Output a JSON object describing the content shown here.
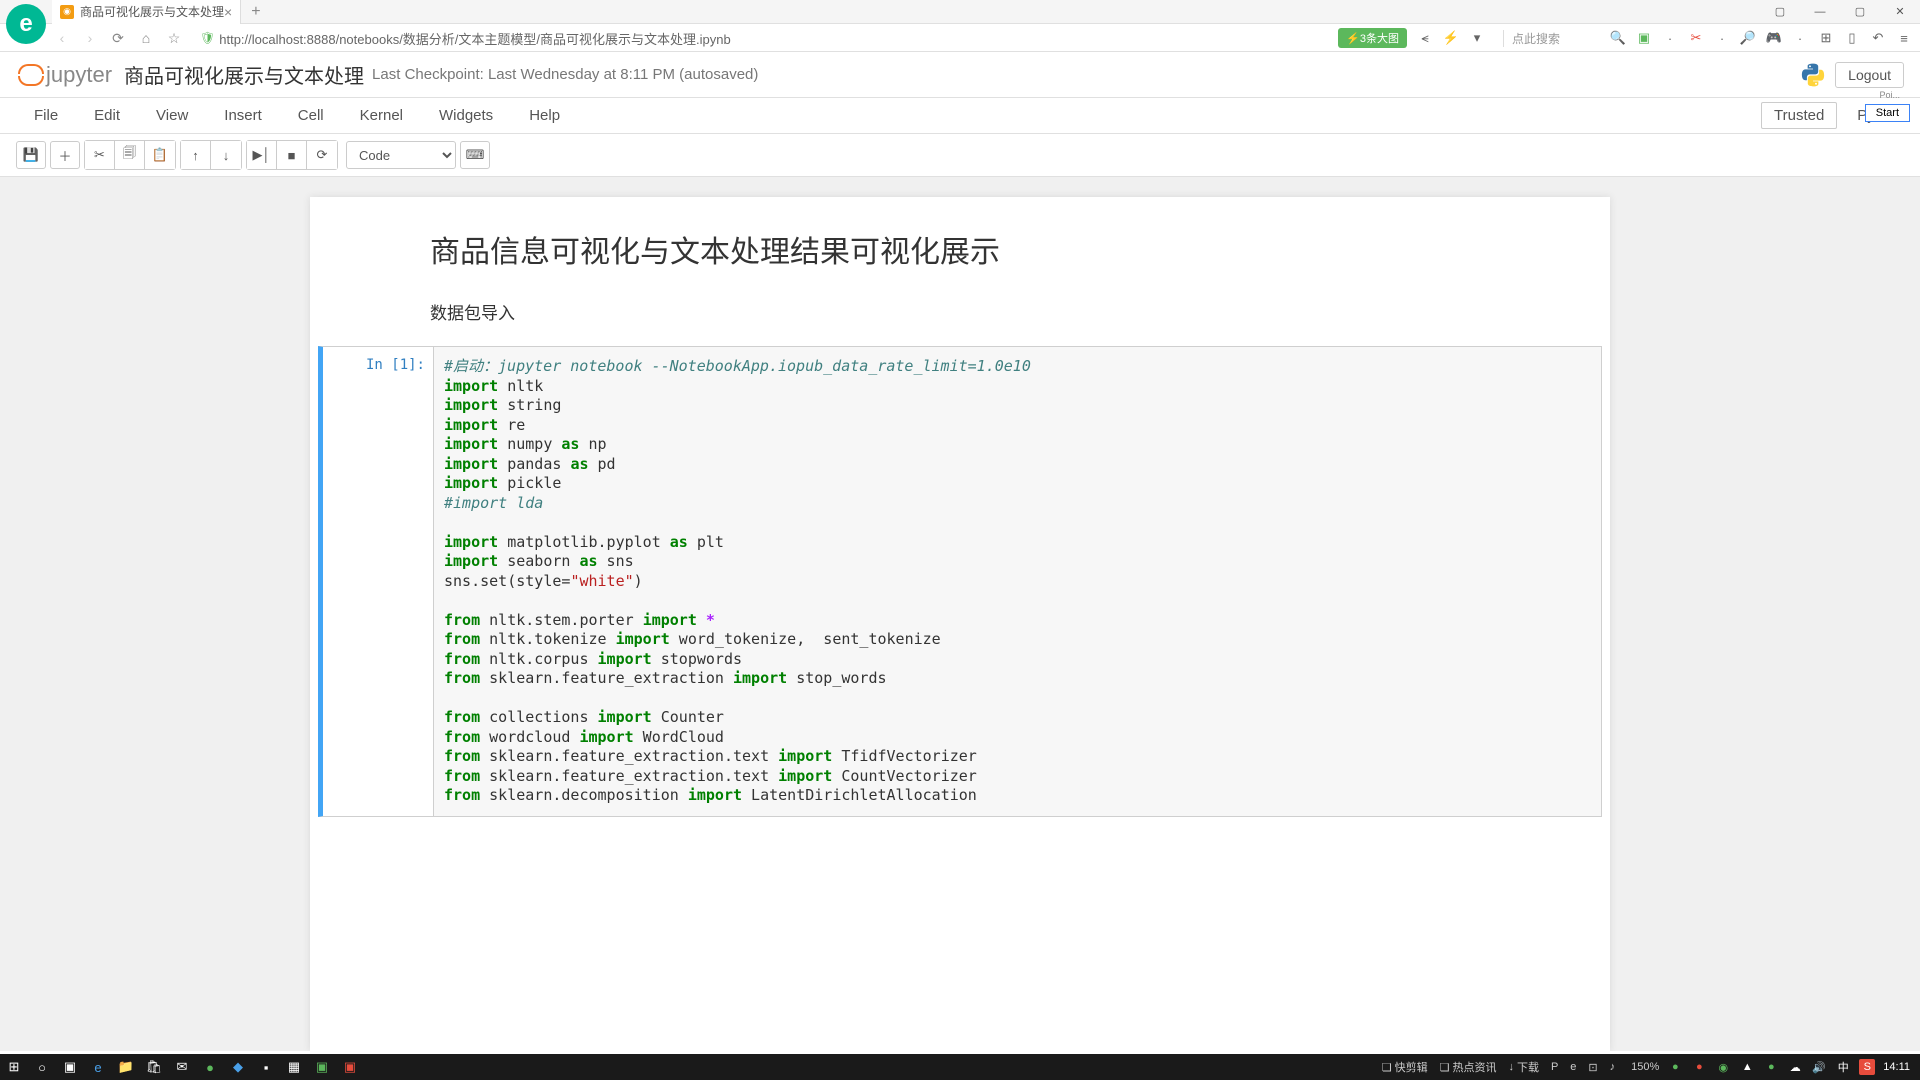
{
  "browser": {
    "tab_title": "商品可视化展示与文本处理",
    "url": "http://localhost:8888/notebooks/数据分析/文本主题模型/商品可视化展示与文本处理.ipynb",
    "ext_badge": "⚡3条大图",
    "search_hint": "点此搜索",
    "win": {
      "menu": "☰",
      "min": "—",
      "max": "▢",
      "close": "✕"
    }
  },
  "jupyter": {
    "logo_text": "jupyter",
    "title": "商品可视化展示与文本处理",
    "checkpoint": "Last Checkpoint: Last Wednesday at 8:11 PM (autosaved)",
    "logout": "Logout",
    "poi": "Poi...",
    "start": "Start"
  },
  "menu": {
    "items": [
      "File",
      "Edit",
      "View",
      "Insert",
      "Cell",
      "Kernel",
      "Widgets",
      "Help"
    ],
    "trusted": "Trusted",
    "kernel": "Python"
  },
  "toolbar": {
    "cell_type": "Code"
  },
  "notebook": {
    "heading": "商品信息可视化与文本处理结果可视化展示",
    "subtext": "数据包导入",
    "prompt": "In [1]:",
    "code": {
      "l1": "#启动：jupyter notebook --NotebookApp.iopub_data_rate_limit=1.0e10",
      "l2a": "import",
      "l2b": " nltk",
      "l3a": "import",
      "l3b": " string",
      "l4a": "import",
      "l4b": " re",
      "l5a": "import",
      "l5b": " numpy ",
      "l5c": "as",
      "l5d": " np",
      "l6a": "import",
      "l6b": " pandas ",
      "l6c": "as",
      "l6d": " pd",
      "l7a": "import",
      "l7b": " pickle",
      "l8": "#import lda",
      "l9a": "import",
      "l9b": " matplotlib.pyplot ",
      "l9c": "as",
      "l9d": " plt",
      "l10a": "import",
      "l10b": " seaborn ",
      "l10c": "as",
      "l10d": " sns",
      "l11a": "sns.set(style=",
      "l11b": "\"white\"",
      "l11c": ")",
      "l12a": "from",
      "l12b": " nltk.stem.porter ",
      "l12c": "import",
      "l12d": " ",
      "l12e": "*",
      "l13a": "from",
      "l13b": " nltk.tokenize ",
      "l13c": "import",
      "l13d": " word_tokenize,  sent_tokenize",
      "l14a": "from",
      "l14b": " nltk.corpus ",
      "l14c": "import",
      "l14d": " stopwords",
      "l15a": "from",
      "l15b": " sklearn.feature_extraction ",
      "l15c": "import",
      "l15d": " stop_words",
      "l16a": "from",
      "l16b": " collections ",
      "l16c": "import",
      "l16d": " Counter",
      "l17a": "from",
      "l17b": " wordcloud ",
      "l17c": "import",
      "l17d": " WordCloud",
      "l18a": "from",
      "l18b": " sklearn.feature_extraction.text ",
      "l18c": "import",
      "l18d": " TfidfVectorizer",
      "l19a": "from",
      "l19b": " sklearn.feature_extraction.text ",
      "l19c": "import",
      "l19d": " CountVectorizer",
      "l20a": "from",
      "l20b": " sklearn.decomposition ",
      "l20c": "import",
      "l20d": " LatentDirichletAllocation"
    }
  },
  "taskbar": {
    "status": [
      {
        "icon": "❏",
        "label": "快剪辑"
      },
      {
        "icon": "❏",
        "label": "热点资讯"
      },
      {
        "icon": "↓",
        "label": "下载"
      },
      {
        "icon": "P",
        "label": ""
      }
    ],
    "zoom": "150%",
    "lang": "中",
    "time": "14:11"
  }
}
